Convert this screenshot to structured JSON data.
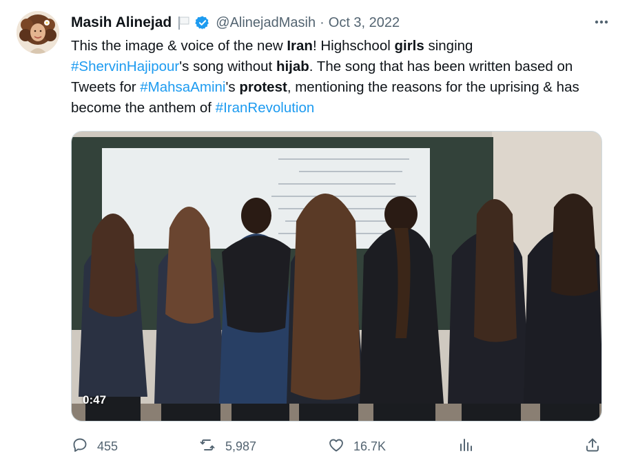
{
  "author": {
    "display_name": "Masih Alinejad",
    "handle": "@AlinejadMasih",
    "separator": "·",
    "date": "Oct 3, 2022"
  },
  "tweet": {
    "segments": [
      {
        "text": "This the image & voice of the new ",
        "style": "plain"
      },
      {
        "text": "Iran",
        "style": "bold"
      },
      {
        "text": "! Highschool ",
        "style": "plain"
      },
      {
        "text": "girls",
        "style": "bold"
      },
      {
        "text": " singing ",
        "style": "plain"
      },
      {
        "text": "#ShervinHajipour",
        "style": "hashtag"
      },
      {
        "text": "'s song without ",
        "style": "plain"
      },
      {
        "text": "hijab",
        "style": "bold"
      },
      {
        "text": ". The song that has been written based on Tweets for ",
        "style": "plain"
      },
      {
        "text": "#MahsaAmini",
        "style": "hashtag"
      },
      {
        "text": "'s ",
        "style": "plain"
      },
      {
        "text": "protest",
        "style": "bold"
      },
      {
        "text": ", mentioning the reasons for the uprising & has become the anthem of ",
        "style": "plain"
      },
      {
        "text": "#IranRevolution",
        "style": "hashtag"
      }
    ]
  },
  "media": {
    "duration": "0:47"
  },
  "actions": {
    "replies": "455",
    "retweets": "5,987",
    "likes": "16.7K"
  },
  "colors": {
    "link": "#1d9bf0",
    "muted": "#536471",
    "text": "#0f1419",
    "verified": "#1d9bf0"
  },
  "icons": {
    "more": "more-horizontal-icon",
    "reply": "reply-icon",
    "retweet": "retweet-icon",
    "like": "heart-icon",
    "views": "analytics-icon",
    "share": "share-icon"
  }
}
